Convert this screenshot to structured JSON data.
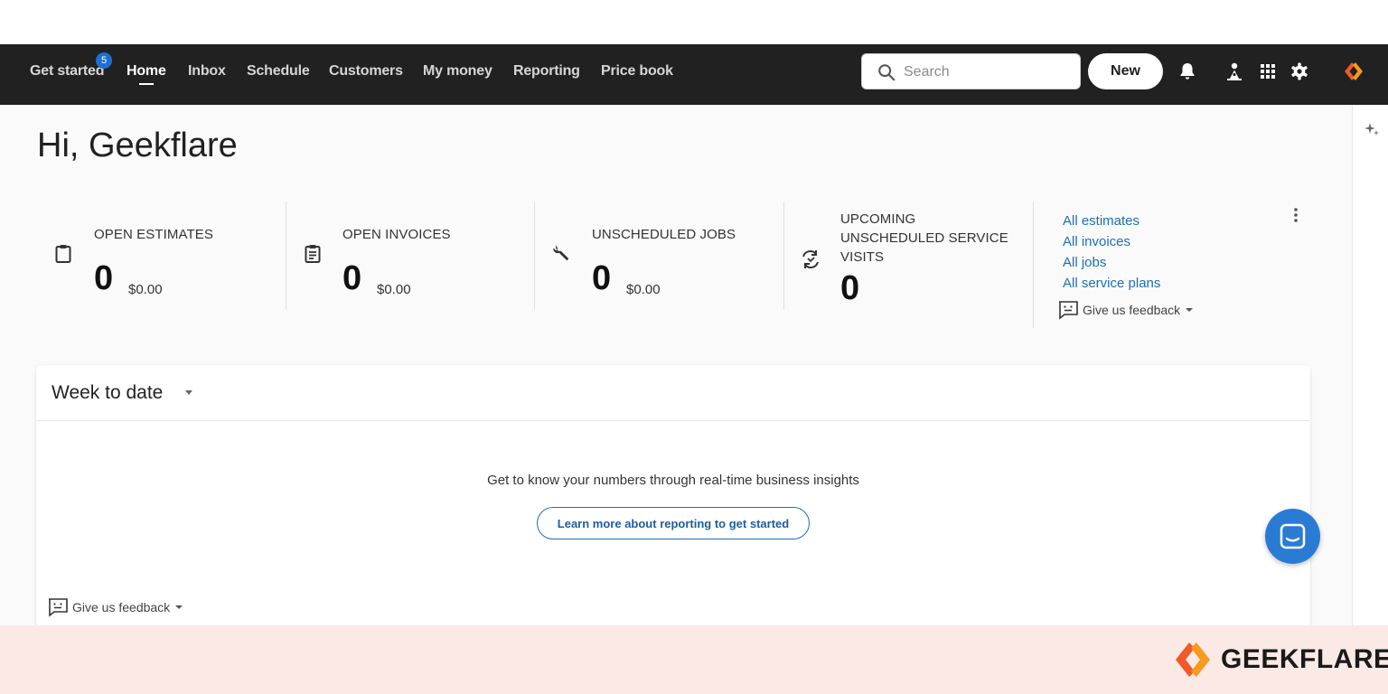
{
  "nav": {
    "items": [
      {
        "label": "Get started",
        "badge": "5"
      },
      {
        "label": "Home",
        "active": true
      },
      {
        "label": "Inbox"
      },
      {
        "label": "Schedule"
      },
      {
        "label": "Customers"
      },
      {
        "label": "My money"
      },
      {
        "label": "Reporting"
      },
      {
        "label": "Price book"
      }
    ],
    "search_placeholder": "Search",
    "new_label": "New",
    "icons": [
      "bell-icon",
      "person-pin-icon",
      "apps-grid-icon",
      "gear-icon",
      "brand-logo-icon"
    ]
  },
  "greeting": "Hi, Geekflare",
  "stats": [
    {
      "label": "OPEN ESTIMATES",
      "count": "0",
      "amount": "$0.00",
      "icon": "clipboard-icon"
    },
    {
      "label": "OPEN INVOICES",
      "count": "0",
      "amount": "$0.00",
      "icon": "invoice-icon"
    },
    {
      "label": "UNSCHEDULED JOBS",
      "count": "0",
      "amount": "$0.00",
      "icon": "wrench-icon"
    },
    {
      "label_lines": [
        "UPCOMING",
        "UNSCHEDULED SERVICE",
        "VISITS"
      ],
      "count": "0",
      "icon": "service-visits-icon"
    }
  ],
  "quick_links": [
    "All estimates",
    "All invoices",
    "All jobs",
    "All service plans"
  ],
  "feedback_label": "Give us feedback",
  "card": {
    "title": "Week to date",
    "message": "Get to know your numbers through real-time business insights",
    "button_label": "Learn more about reporting to get started"
  },
  "watermark": "GEEKFLARE",
  "colors": {
    "navbar": "#212121",
    "link": "#1e6fb5",
    "accent": "#2a7bd4",
    "brand": "#f05a28",
    "footer": "#fbe9e5"
  }
}
